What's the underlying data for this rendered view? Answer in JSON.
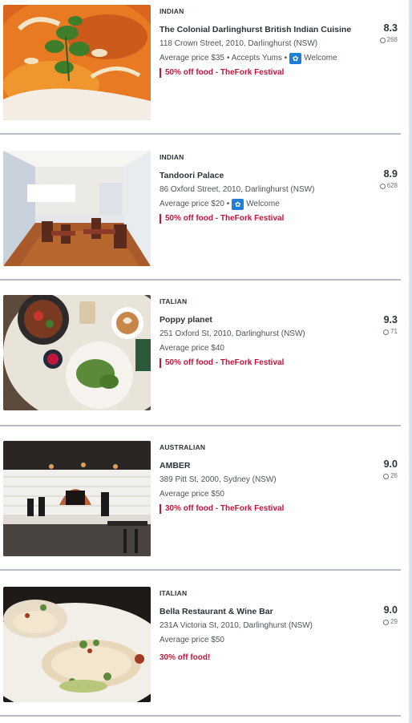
{
  "restaurants": [
    {
      "cuisine": "INDIAN",
      "name": "The Colonial Darlinghurst British Indian Cuisine",
      "address": "118 Crown Street, 2010, Darlinghurst (NSW)",
      "price": "Average price $35",
      "extras": "• Accepts Yums •",
      "welcome": "Welcome",
      "offer": "50% off food - TheFork Festival",
      "score": "8.3",
      "reviews": "268",
      "photo_icon": "curry-dish-photo"
    },
    {
      "cuisine": "INDIAN",
      "name": "Tandoori Palace",
      "address": "86 Oxford Street, 2010, Darlinghurst (NSW)",
      "price": "Average price $20 •",
      "welcome": "Welcome",
      "offer": "50% off food - TheFork Festival",
      "score": "8.9",
      "reviews": "628",
      "photo_icon": "dining-room-photo"
    },
    {
      "cuisine": "ITALIAN",
      "name": "Poppy planet",
      "address": "251 Oxford St, 2010, Darlinghurst (NSW)",
      "price": "Average price $40",
      "offer": "50% off food - TheFork Festival",
      "score": "9.3",
      "reviews": "71",
      "photo_icon": "table-dishes-photo"
    },
    {
      "cuisine": "AUSTRALIAN",
      "name": "AMBER",
      "address": "389 Pitt St, 2000, Sydney (NSW)",
      "price": "Average price $50",
      "offer": "30% off food - TheFork Festival",
      "score": "9.0",
      "reviews": "26",
      "photo_icon": "open-kitchen-photo"
    },
    {
      "cuisine": "ITALIAN",
      "name": "Bella Restaurant & Wine Bar",
      "address": "231A Victoria St, 2010, Darlinghurst (NSW)",
      "price": "Average price $50",
      "offer": "30% off food!",
      "score": "9.0",
      "reviews": "29",
      "photo_icon": "seafood-plate-photo"
    }
  ],
  "colors": {
    "offer_red": "#c4143c",
    "badge_blue": "#1f7ed6",
    "divider_gray": "#b8bcc0"
  }
}
